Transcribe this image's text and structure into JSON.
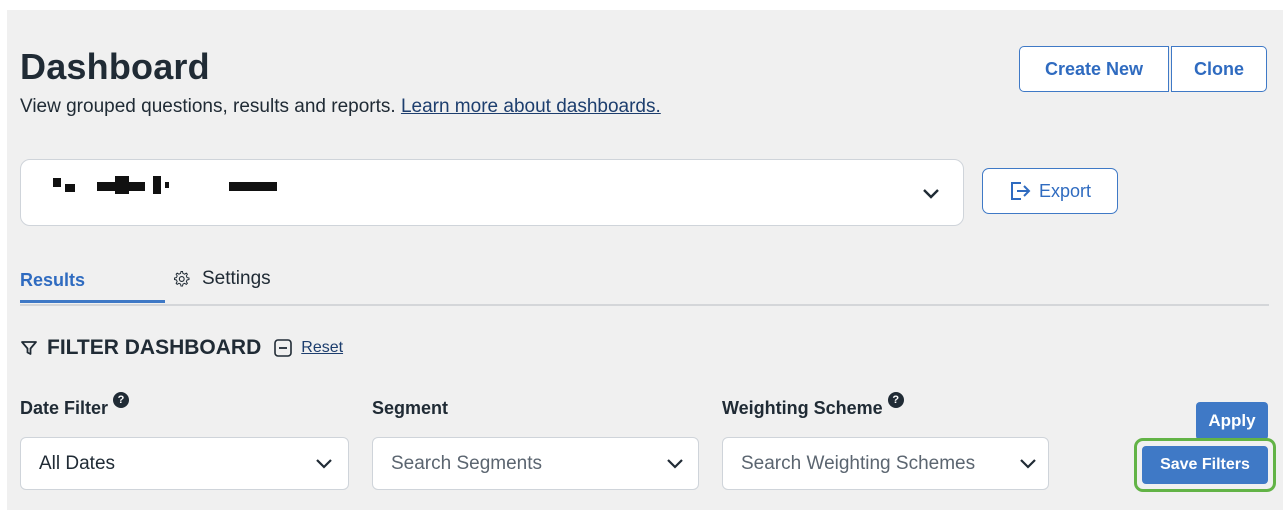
{
  "header": {
    "title": "Dashboard",
    "subtitle": "View grouped questions, results and reports. ",
    "learn_more_link": "Learn more about dashboards.",
    "create_new_label": "Create New",
    "clone_label": "Clone"
  },
  "dashboard_selector": {
    "selected_value_redacted": true,
    "icons": [
      "chevron-down-icon"
    ]
  },
  "export": {
    "label": "Export",
    "icon": "export-icon"
  },
  "tabs": [
    {
      "label": "Results",
      "active": true
    },
    {
      "label": "Settings",
      "active": false,
      "icon": "gear-icon"
    }
  ],
  "filter": {
    "heading": "FILTER DASHBOARD",
    "reset_label": "Reset",
    "icons": [
      "filter-icon",
      "collapse-icon"
    ],
    "fields": [
      {
        "label": "Date Filter",
        "has_help": true,
        "value": "All Dates"
      },
      {
        "label": "Segment",
        "has_help": false,
        "placeholder": "Search Segments"
      },
      {
        "label": "Weighting Scheme",
        "has_help": true,
        "placeholder": "Search Weighting Schemes"
      }
    ],
    "help_glyph": "?",
    "apply_label": "Apply",
    "save_label": "Save Filters"
  },
  "colors": {
    "accent": "#3f79c6",
    "highlight": "#62b346",
    "background": "#f0f0f0"
  }
}
